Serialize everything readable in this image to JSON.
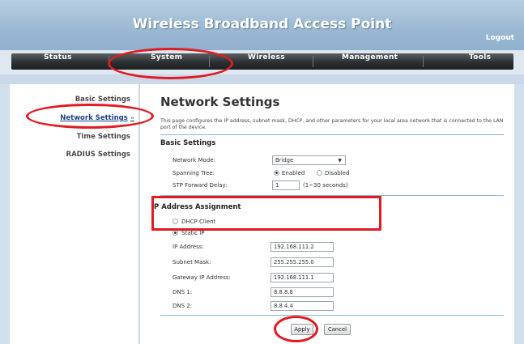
{
  "header": {
    "title": "Wireless Broadband Access Point",
    "logout_label": "Logout"
  },
  "nav": {
    "tabs": [
      {
        "label": "Status"
      },
      {
        "label": "System"
      },
      {
        "label": "Wireless"
      },
      {
        "label": "Management"
      },
      {
        "label": "Tools"
      }
    ],
    "active_tab": "System"
  },
  "sidebar": {
    "items": [
      {
        "label": "Basic Settings"
      },
      {
        "label": "Network Settings"
      },
      {
        "label": "Time Settings"
      },
      {
        "label": "RADIUS Settings"
      }
    ],
    "active_marker": "»"
  },
  "main": {
    "title": "Network Settings",
    "description": "This page configures the IP address, subnet mask, DHCP, and other parameters for your local area network that is connected to the LAN port of the device.",
    "basic": {
      "heading": "Basic Settings",
      "network_mode_label": "Network Mode:",
      "network_mode_value": "Bridge",
      "spanning_tree_label": "Spanning Tree:",
      "enabled_label": "Enabled",
      "disabled_label": "Disabled",
      "stp_delay_label": "STP Forward Delay:",
      "stp_delay_value": "1",
      "stp_delay_hint": "(1~30 seconds)"
    },
    "ip": {
      "heading": "P Address Assignment",
      "dhcp_label": "DHCP Client",
      "static_label": "Static IP",
      "ip_label": "IP Address:",
      "ip_value": "192.168.111.2",
      "mask_label": "Subnet Mask:",
      "mask_value": "255.255.255.0",
      "gateway_label": "Gateway IP Address:",
      "gateway_value": "192.168.111.1",
      "dns1_label": "DNS 1:",
      "dns1_value": "8.8.8.8",
      "dns2_label": "DNS 2:",
      "dns2_value": "8.8.4.4"
    },
    "buttons": {
      "apply": "Apply",
      "cancel": "Cancel"
    }
  },
  "colors": {
    "annotation": "#e01b22",
    "header": "#9bb8d3",
    "nav": "#2c3033"
  }
}
